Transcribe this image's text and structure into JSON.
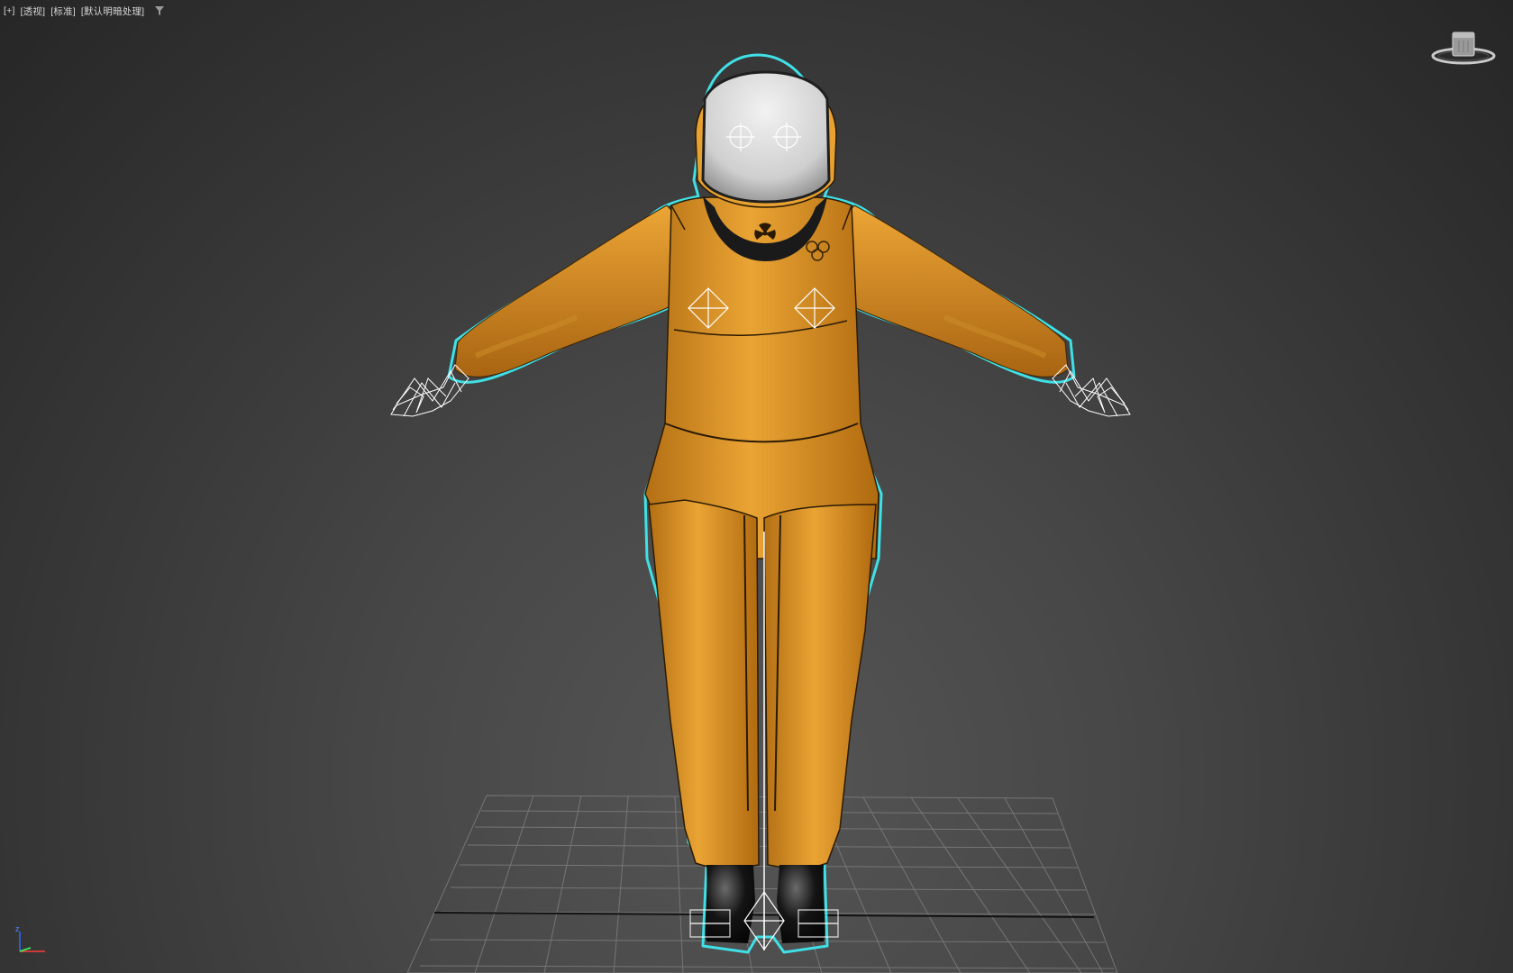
{
  "viewport": {
    "labels": {
      "options_menu": "[+]",
      "view_menu": "[透视]",
      "shading_menu": "[标准]",
      "lighting_menu": "[默认明暗处理]"
    },
    "filter_icon": "filter-icon"
  },
  "viewcube": {
    "icon": "viewcube-icon"
  },
  "axis_tripod": {
    "z_label": "z",
    "icon": "axis-tripod-icon"
  },
  "scene": {
    "model": "hazmat-suit-character",
    "suit_color": "#e29a2a",
    "visor_color": "#dcdcdc",
    "selection_outline_color": "#3fe0e6",
    "grid_color": "#8a8a8a"
  }
}
